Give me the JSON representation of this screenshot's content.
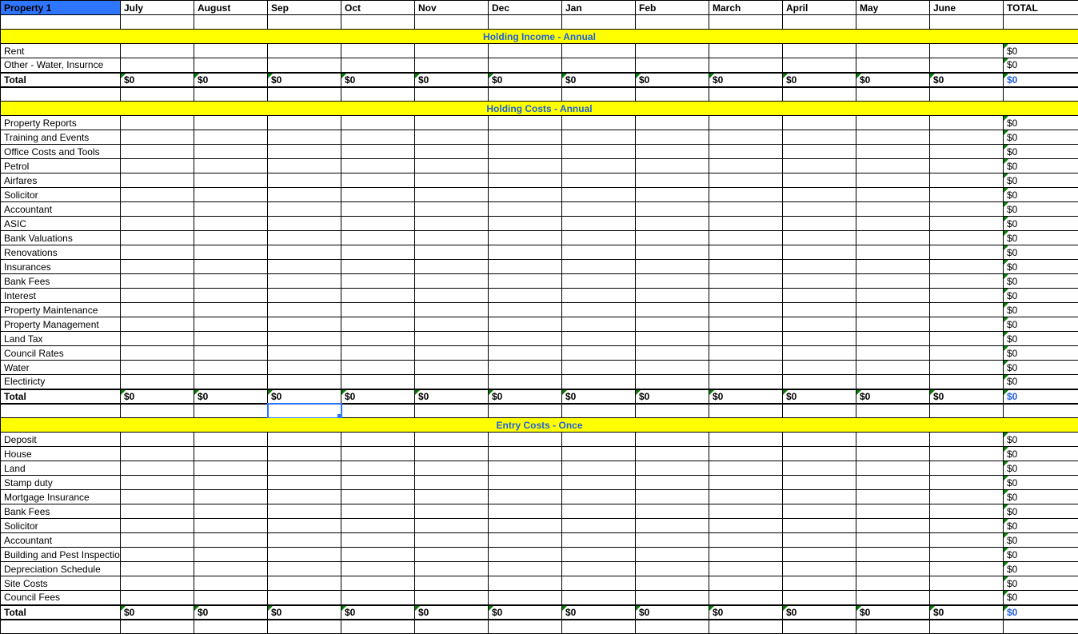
{
  "header": {
    "property": "Property 1",
    "months": [
      "July",
      "August",
      "Sep",
      "Oct",
      "Nov",
      "Dec",
      "Jan",
      "Feb",
      "March",
      "April",
      "May",
      "June"
    ],
    "total": "TOTAL"
  },
  "zero": "$0",
  "sections": [
    {
      "title": "Holding Income - Annual",
      "rows": [
        {
          "label": "Rent",
          "total": "$0"
        },
        {
          "label": "Other - Water, Insurnce",
          "total": "$0"
        }
      ],
      "total": {
        "label": "Total",
        "months": [
          "$0",
          "$0",
          "$0",
          "$0",
          "$0",
          "$0",
          "$0",
          "$0",
          "$0",
          "$0",
          "$0",
          "$0"
        ],
        "total": "$0"
      }
    },
    {
      "title": "Holding Costs - Annual",
      "rows": [
        {
          "label": "Property Reports",
          "total": "$0"
        },
        {
          "label": "Training and Events",
          "total": "$0"
        },
        {
          "label": "Office Costs and Tools",
          "total": "$0"
        },
        {
          "label": "Petrol",
          "total": "$0"
        },
        {
          "label": "Airfares",
          "total": "$0"
        },
        {
          "label": "Solicitor",
          "total": "$0"
        },
        {
          "label": "Accountant",
          "total": "$0"
        },
        {
          "label": "ASIC",
          "total": "$0"
        },
        {
          "label": "Bank Valuations",
          "total": "$0"
        },
        {
          "label": "Renovations",
          "total": "$0"
        },
        {
          "label": "Insurances",
          "total": "$0"
        },
        {
          "label": "Bank Fees",
          "total": "$0"
        },
        {
          "label": "Interest",
          "total": "$0"
        },
        {
          "label": "Property Maintenance",
          "total": "$0"
        },
        {
          "label": "Property Management",
          "total": "$0"
        },
        {
          "label": "Land Tax",
          "total": "$0"
        },
        {
          "label": "Council Rates",
          "total": "$0"
        },
        {
          "label": "Water",
          "total": "$0"
        },
        {
          "label": "Electiricty",
          "total": "$0"
        }
      ],
      "total": {
        "label": "Total",
        "months": [
          "$0",
          "$0",
          "$0",
          "$0",
          "$0",
          "$0",
          "$0",
          "$0",
          "$0",
          "$0",
          "$0",
          "$0"
        ],
        "total": "$0"
      },
      "selected_month_idx": 2
    },
    {
      "title": "Entry Costs - Once",
      "rows": [
        {
          "label": "Deposit",
          "total": "$0"
        },
        {
          "label": "House",
          "total": "$0"
        },
        {
          "label": "Land",
          "total": "$0"
        },
        {
          "label": "Stamp duty",
          "total": "$0"
        },
        {
          "label": "Mortgage Insurance",
          "total": "$0"
        },
        {
          "label": "Bank Fees",
          "total": "$0"
        },
        {
          "label": "Solicitor",
          "total": "$0"
        },
        {
          "label": "Accountant",
          "total": "$0"
        },
        {
          "label": "Building and Pest Inspection",
          "total": "$0"
        },
        {
          "label": "Depreciation Schedule",
          "total": "$0"
        },
        {
          "label": "Site Costs",
          "total": "$0"
        },
        {
          "label": "Council Fees",
          "total": "$0"
        }
      ],
      "total": {
        "label": "Total",
        "months": [
          "$0",
          "$0",
          "$0",
          "$0",
          "$0",
          "$0",
          "$0",
          "$0",
          "$0",
          "$0",
          "$0",
          "$0"
        ],
        "total": "$0"
      }
    }
  ]
}
